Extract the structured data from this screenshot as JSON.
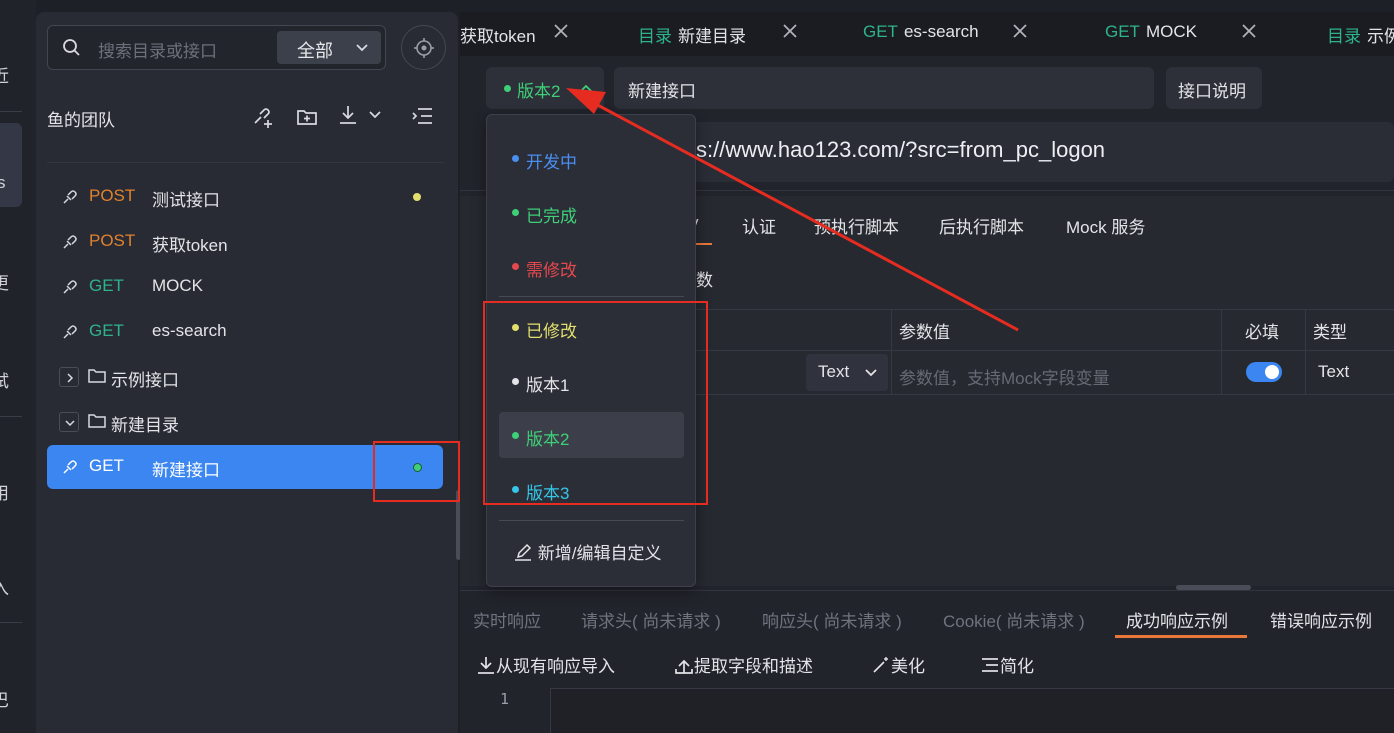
{
  "rail": {
    "items": [
      "近",
      "s",
      "更",
      "试",
      "用",
      "入",
      "巴"
    ]
  },
  "sidebar": {
    "search_placeholder": "搜索目录或接口",
    "filter_value": "全部",
    "team_name": "鱼的团队",
    "items": [
      {
        "method": "POST",
        "name": "测试接口",
        "status_color": "#e3df6c"
      },
      {
        "method": "POST",
        "name": "获取token"
      },
      {
        "method": "GET",
        "name": "MOCK"
      },
      {
        "method": "GET",
        "name": "es-search"
      }
    ],
    "folders": [
      {
        "name": "示例接口",
        "expanded": false
      },
      {
        "name": "新建目录",
        "expanded": true
      }
    ],
    "selected_item": {
      "method": "GET",
      "name": "新建接口",
      "status_color": "#3ecf78"
    }
  },
  "tabs": [
    {
      "prefix": "",
      "name": "获取token"
    },
    {
      "prefix": "目录",
      "name": "新建目录"
    },
    {
      "prefix": "GET",
      "name": "es-search"
    },
    {
      "prefix": "GET",
      "name": "MOCK"
    },
    {
      "prefix": "目录",
      "name": "示例"
    }
  ],
  "editor": {
    "version_label": "版本2",
    "version_color": "#3ecf78",
    "name": "新建接口",
    "doc_button": "接口说明",
    "url": "s://www.hao123.com/?src=from_pc_logon"
  },
  "request_tabs": [
    "y",
    "认证",
    "预执行脚本",
    "后执行脚本",
    "Mock 服务"
  ],
  "params": {
    "label": "数",
    "headers": [
      "参数值",
      "必填",
      "类型"
    ],
    "row": {
      "type_select": "Text",
      "value_placeholder": "参数值，支持Mock字段变量",
      "required": true,
      "type": "Text"
    }
  },
  "dropdown": {
    "items": [
      {
        "label": "开发中",
        "color": "#4a8ef0"
      },
      {
        "label": "已完成",
        "color": "#3ecf78"
      },
      {
        "label": "需修改",
        "color": "#e5484d"
      },
      {
        "label": "已修改",
        "color": "#e3df6c"
      },
      {
        "label": "版本1",
        "color": "#e3e4e8"
      },
      {
        "label": "版本2",
        "color": "#3ecf78",
        "selected": true
      },
      {
        "label": "版本3",
        "color": "#35c6e8"
      }
    ],
    "edit_label": "新增/编辑自定义"
  },
  "response": {
    "tabs": [
      {
        "label": "实时响应"
      },
      {
        "label": "请求头( 尚未请求 )"
      },
      {
        "label": "响应头( 尚未请求 )"
      },
      {
        "label": "Cookie( 尚未请求 )"
      },
      {
        "label": "成功响应示例",
        "active": true
      },
      {
        "label": "错误响应示例"
      }
    ],
    "tools": [
      "从现有响应导入",
      "提取字段和描述",
      "美化",
      "简化"
    ],
    "line_number": "1"
  },
  "annotation_color": "#e62c21"
}
